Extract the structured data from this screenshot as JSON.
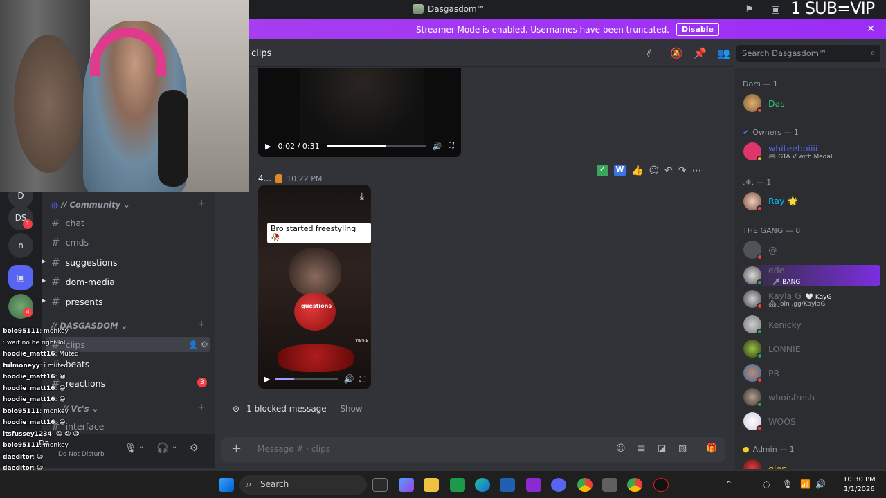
{
  "window": {
    "title": "Dasgasdom™"
  },
  "stream_overlay": {
    "sub_text": "1 SUB=VIP"
  },
  "banner": {
    "text": "Streamer Mode is enabled. Usernames have been truncated.",
    "disable_label": "Disable"
  },
  "header": {
    "channel": "clips",
    "search_placeholder": "Search Dasgasdom™"
  },
  "messages": {
    "video1": {
      "time": "0:02 / 0:31",
      "progress": 0.6
    },
    "msg2": {
      "user": "4...",
      "timestamp": "10:22 PM"
    },
    "video2": {
      "caption": "Bro started freestyling 🥀",
      "label": "questions",
      "tiktok": "TikTok",
      "progress": 0.3
    },
    "blocked": {
      "text": "1 blocked message —",
      "show": "Show"
    }
  },
  "composer": {
    "placeholder": "Message # · clips"
  },
  "rail": {
    "items": [
      "D",
      "DS",
      "n"
    ],
    "badges": [
      "1",
      "4"
    ]
  },
  "channels": {
    "categories": [
      {
        "name": "// Community"
      },
      {
        "name": "// DASGASDOM"
      },
      {
        "name": "// Vc's"
      }
    ],
    "items": [
      {
        "name": "chat"
      },
      {
        "name": "cmds"
      },
      {
        "name": "suggestions"
      },
      {
        "name": "dom-media"
      },
      {
        "name": "presents"
      },
      {
        "name": "clips"
      },
      {
        "name": "beats"
      },
      {
        "name": "reactions",
        "badge": "3"
      },
      {
        "name": "interface"
      }
    ]
  },
  "chat_overlay": {
    "lines": [
      {
        "user": "bolo95111",
        "text": ": monkey"
      },
      {
        "user": "",
        "text": ": wait no he right lol"
      },
      {
        "user": "hoodie_matt16",
        "text": ": Muted"
      },
      {
        "user": "tulmoneyy",
        "text": ": i muted"
      },
      {
        "user": "hoodie_matt16",
        "text": ": 😀"
      },
      {
        "user": "hoodie_matt16",
        "text": ": 😀"
      },
      {
        "user": "hoodie_matt16",
        "text": ": 😀"
      },
      {
        "user": "bolo95111",
        "text": ": monkey"
      },
      {
        "user": "hoodie_matt16",
        "text": ": 😀"
      },
      {
        "user": "itsfussey1234",
        "text": ": 😀 😀 😀"
      },
      {
        "user": "bolo95111",
        "text": ": monkey"
      },
      {
        "user": "daeditor",
        "text": ": 😀"
      },
      {
        "user": "daeditor",
        "text": ": 😀"
      },
      {
        "user": "daeditor",
        "text": ": 😀"
      }
    ]
  },
  "userpanel": {
    "name": "Da...",
    "status": "Do Not Disturb"
  },
  "members": {
    "groups": [
      {
        "name": "Dom — 1"
      },
      {
        "name": "Owners — 1"
      },
      {
        "name": ".❄. — 1"
      },
      {
        "name": "THE GANG — 8"
      },
      {
        "name": "Admin — 1"
      }
    ],
    "list": [
      {
        "name": "Das",
        "color": "#2dc770",
        "status_color": "#f23f43"
      },
      {
        "name": "whiteeboiiii",
        "sub": "🎮 GTA V with Medal",
        "color": "#5865f2",
        "status_color": "#f0b232"
      },
      {
        "name": "Ray 🌟",
        "color": "#00c3ff",
        "status_color": "#f23f43"
      },
      {
        "name": "@",
        "color": "#6d6f78",
        "status_color": "#f23f43"
      },
      {
        "name": "ede",
        "tag": "🗡 BANG",
        "color": "#6d6f78",
        "status_color": "#23a55a"
      },
      {
        "name": "Kayla G",
        "tag": "🤍 KayG",
        "sub": "🏘 Join .gg/KaylaG",
        "color": "#6d6f78",
        "status_color": "#f23f43"
      },
      {
        "name": "Kenicky",
        "color": "#6d6f78",
        "status_color": "#23a55a"
      },
      {
        "name": "LONNIE",
        "color": "#6d6f78",
        "status_color": "#23a55a"
      },
      {
        "name": "PR",
        "color": "#6d6f78",
        "status_color": "#f23f43"
      },
      {
        "name": "whoisfresh",
        "color": "#6d6f78",
        "status_color": "#23a55a"
      },
      {
        "name": "WOOS",
        "color": "#6d6f78",
        "status_color": "#f23f43"
      },
      {
        "name": "glen",
        "color": "#f0b232",
        "status_color": "#23a55a"
      }
    ]
  },
  "taskbar": {
    "search_label": "Search",
    "time": "10:30 PM",
    "date": "1/1/2026"
  }
}
